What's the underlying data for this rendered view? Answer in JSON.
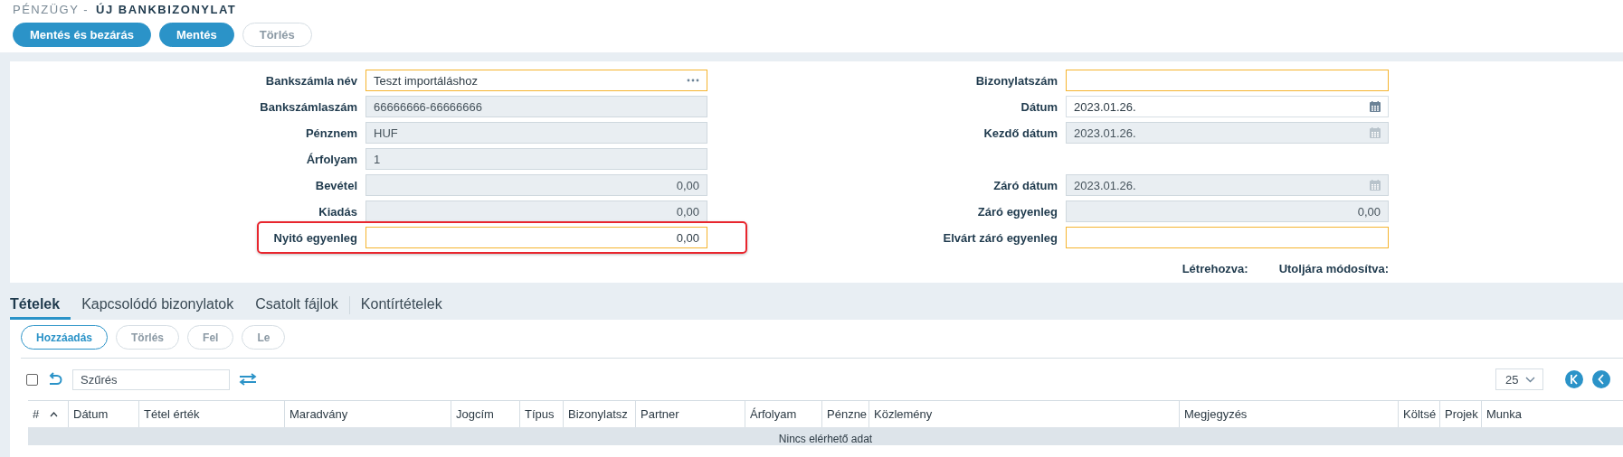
{
  "breadcrumb": {
    "section": "PÉNZÜGY -",
    "title": "ÚJ BANKBIZONYLAT"
  },
  "actions": [
    {
      "label": "Mentés és bezárás",
      "disabled": false
    },
    {
      "label": "Mentés",
      "disabled": false
    },
    {
      "label": "Törlés",
      "disabled": true
    }
  ],
  "form": {
    "left": [
      {
        "kind": "lookup",
        "label": "Bankszámla név",
        "value": "Teszt importáláshoz",
        "readonly": false,
        "required": true,
        "highlighted": false
      },
      {
        "kind": "text",
        "label": "Bankszámlaszám",
        "value": "66666666-66666666",
        "readonly": true,
        "required": false,
        "highlighted": false
      },
      {
        "kind": "text",
        "label": "Pénznem",
        "value": "HUF",
        "readonly": true,
        "required": false,
        "highlighted": false
      },
      {
        "kind": "text",
        "label": "Árfolyam",
        "value": "1",
        "readonly": true,
        "required": false,
        "highlighted": false
      },
      {
        "kind": "number",
        "label": "Bevétel",
        "value": "0,00",
        "readonly": true,
        "required": false,
        "highlighted": false
      },
      {
        "kind": "number",
        "label": "Kiadás",
        "value": "0,00",
        "readonly": true,
        "required": false,
        "highlighted": false
      },
      {
        "kind": "number",
        "label": "Nyitó egyenleg",
        "value": "0,00",
        "readonly": false,
        "required": true,
        "highlighted": true
      }
    ],
    "right": [
      {
        "kind": "text",
        "label": "Bizonylatszám",
        "readonly": false,
        "required": true
      },
      {
        "kind": "date",
        "label": "Dátum",
        "value": "2023.01.26.",
        "readonly": false,
        "required": false
      },
      {
        "kind": "date",
        "label": "Kezdő dátum",
        "value": "2023.01.26.",
        "readonly": true,
        "required": false
      },
      {
        "kind": "spacer"
      },
      {
        "kind": "date",
        "label": "Záró dátum",
        "value": "2023.01.26.",
        "readonly": true,
        "required": false
      },
      {
        "kind": "number",
        "label": "Záró egyenleg",
        "value": "0,00",
        "readonly": true,
        "required": false
      },
      {
        "kind": "text",
        "label": "Elvárt záró egyenleg",
        "readonly": false,
        "required": true
      }
    ],
    "footer": [
      "Létrehozva:",
      "Utoljára módosítva:"
    ]
  },
  "tabs": [
    {
      "label": "Tételek",
      "selected": true,
      "separator": false
    },
    {
      "label": "Kapcsolódó bizonylatok",
      "selected": false,
      "separator": false
    },
    {
      "label": "Csatolt fájlok",
      "selected": false,
      "separator": true
    },
    {
      "label": "Kontírtételek",
      "selected": false,
      "separator": false
    }
  ],
  "item_actions": [
    {
      "label": "Hozzáadás",
      "disabled": false
    },
    {
      "label": "Törlés",
      "disabled": true
    },
    {
      "label": "Fel",
      "disabled": true
    },
    {
      "label": "Le",
      "disabled": true
    }
  ],
  "filter": {
    "select_all": false,
    "placeholder": "Szűrés"
  },
  "page_size": "25",
  "table": {
    "columns": [
      {
        "label": "#",
        "sorted": true
      },
      {
        "label": "Dátum",
        "sorted": false
      },
      {
        "label": "Tétel érték",
        "sorted": false
      },
      {
        "label": "Maradvány",
        "sorted": false
      },
      {
        "label": "Jogcím",
        "sorted": false
      },
      {
        "label": "Típus",
        "sorted": false
      },
      {
        "label": "Bizonylatsz",
        "sorted": false
      },
      {
        "label": "Partner",
        "sorted": false
      },
      {
        "label": "Árfolyam",
        "sorted": false
      },
      {
        "label": "Pénzne",
        "sorted": false
      },
      {
        "label": "Közlemény",
        "sorted": false
      },
      {
        "label": "Megjegyzés",
        "sorted": false
      },
      {
        "label": "Költsé",
        "sorted": false
      },
      {
        "label": "Projek",
        "sorted": false
      },
      {
        "label": "Munka",
        "sorted": false
      }
    ],
    "empty_text": "Nincs elérhető adat"
  }
}
